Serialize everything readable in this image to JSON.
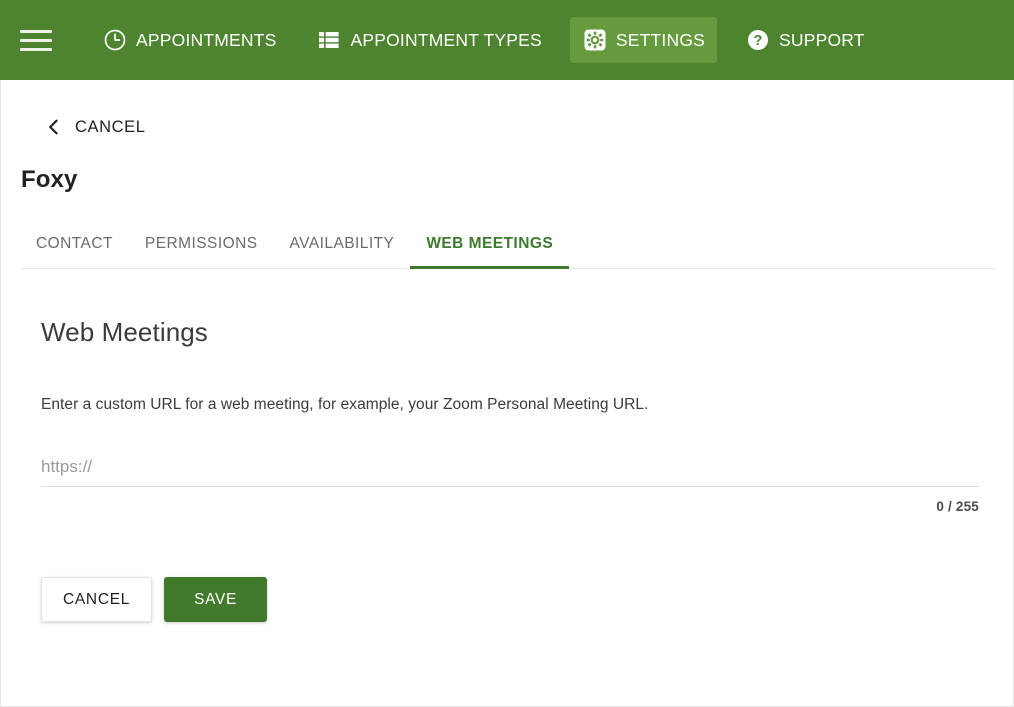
{
  "topnav": {
    "menu_icon": "hamburger-menu-icon",
    "items": [
      {
        "label": "APPOINTMENTS",
        "icon": "clock-icon",
        "active": false
      },
      {
        "label": "APPOINTMENT TYPES",
        "icon": "list-view-icon",
        "active": false
      },
      {
        "label": "SETTINGS",
        "icon": "gear-icon",
        "active": true
      },
      {
        "label": "SUPPORT",
        "icon": "question-circle-icon",
        "active": false
      }
    ]
  },
  "back": {
    "label": "CANCEL",
    "icon": "chevron-left-icon"
  },
  "entity": {
    "title": "Foxy"
  },
  "tabs": [
    {
      "label": "CONTACT",
      "active": false
    },
    {
      "label": "PERMISSIONS",
      "active": false
    },
    {
      "label": "AVAILABILITY",
      "active": false
    },
    {
      "label": "WEB MEETINGS",
      "active": true
    }
  ],
  "section": {
    "heading": "Web Meetings",
    "description": "Enter a custom URL for a web meeting, for example, your Zoom Personal Meeting URL.",
    "url_field": {
      "value": "",
      "placeholder": "https://",
      "counter": "0 / 255",
      "max_length": "255"
    }
  },
  "actions": {
    "cancel_label": "CANCEL",
    "save_label": "SAVE"
  },
  "colors": {
    "header_green": "#4E8430",
    "active_nav_green": "#669A3E",
    "accent_green": "#3D7A2E",
    "save_green": "#417A2B",
    "text_dark": "#212121",
    "text_muted": "#6b6b6b"
  }
}
